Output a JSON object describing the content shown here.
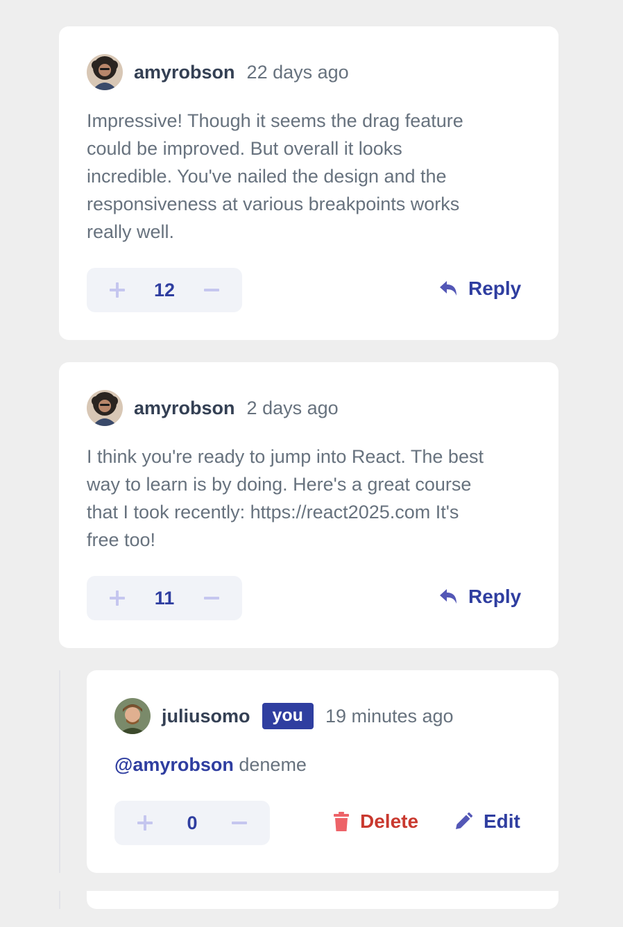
{
  "comments": [
    {
      "username": "amyrobson",
      "timestamp": "22 days ago",
      "text_lines": [
        "Impressive! Though it seems the drag feature",
        "could be improved. But overall it looks",
        "incredible. You've nailed the design and the",
        "responsiveness at various breakpoints works",
        "really well."
      ],
      "score": "12",
      "reply_label": "Reply"
    },
    {
      "username": "amyrobson",
      "timestamp": "2 days ago",
      "text_lines": [
        "I think you're ready to jump into React. The best",
        "way to learn is by doing. Here's a great course",
        "that I took recently: https://react2025.com It's",
        "free too!"
      ],
      "score": "11",
      "reply_label": "Reply"
    }
  ],
  "reply": {
    "username": "juliusomo",
    "you_badge": "you",
    "timestamp": "19 minutes ago",
    "mention": "@amyrobson",
    "text": " deneme",
    "score": "0",
    "delete_label": "Delete",
    "edit_label": "Edit"
  },
  "colors": {
    "background": "#eeeeee",
    "card": "#ffffff",
    "primary": "#2f3ea0",
    "danger": "#c9392f",
    "text": "#67727e",
    "vote_bg": "#f1f3f8"
  },
  "icons": {
    "plus": "plus-icon",
    "minus": "minus-icon",
    "reply": "reply-icon",
    "delete": "trash-icon",
    "edit": "pencil-icon"
  }
}
